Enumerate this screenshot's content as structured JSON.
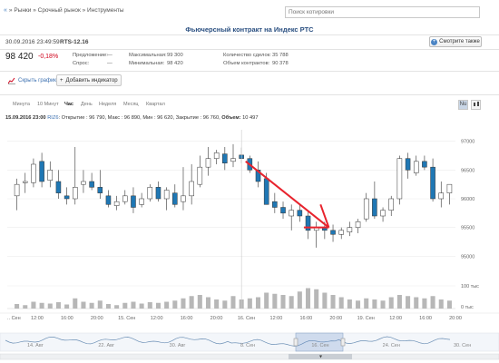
{
  "breadcrumb": {
    "home": "«",
    "path": "» Рынки » Срочный рынок » Инструменты"
  },
  "search": {
    "placeholder": "Поиск котировки"
  },
  "title": "Фьючерсный контракт на Индекс РТС",
  "header": {
    "datetime": "30.09.2016 23:49:59",
    "ticker": "RTS-12.16",
    "watch_label": "Смотрите также",
    "price": "98 420",
    "change": "-0,18%"
  },
  "stats": [
    {
      "label": "Предложение:",
      "value": "—"
    },
    {
      "label": "Спрос:",
      "value": "—"
    },
    {
      "label": "Максимальная:",
      "value": "99 300"
    },
    {
      "label": "Минимальная:",
      "value": "98 420"
    },
    {
      "label": "Количество сделок:",
      "value": "35 788"
    },
    {
      "label": "Объем контрактов:",
      "value": "90 378"
    }
  ],
  "toolbar": {
    "hide_chart": "Скрыть график",
    "add_indicator": "Добавить индикатор"
  },
  "periods": [
    "Минута",
    "10 Минут",
    "Час",
    "День",
    "Неделя",
    "Месяц",
    "Квартал"
  ],
  "active_period": "Час",
  "chart_controls": [
    "Nu"
  ],
  "ohlc": {
    "datetime": "15.09.2016 23:00",
    "ticker": "RIZ6",
    "text": ": Открытие : 96 790, Макс : 96 890, Мин : 96 620, Закрытие : 96 760,",
    "volume_label": "Объем:",
    "volume": "10 497"
  },
  "colors": {
    "up": "#ffffff",
    "down": "#1f77b4",
    "arrow": "#e8232d",
    "title": "#2a4f80"
  },
  "chart_data": {
    "type": "candlestick",
    "y_ticks": [
      "97000",
      "96500",
      "96000",
      "95500",
      "95000"
    ],
    "ylim": [
      94800,
      97200
    ],
    "volume_ticks": [
      "100 тыс",
      "0 тыс"
    ],
    "volume_max": 100,
    "x_labels": [
      ".. Сен",
      "12:00",
      "16:00",
      "20:00",
      "15. Сен",
      "12:00",
      "16:00",
      "20:00",
      "16. Сен",
      "12:00",
      "16:00",
      "20:00",
      "19. Сен",
      "12:00",
      "16:00",
      "20:00"
    ],
    "candles": [
      {
        "o": 96050,
        "h": 96350,
        "l": 95800,
        "c": 96250
      },
      {
        "o": 96280,
        "h": 96450,
        "l": 96100,
        "c": 96300
      },
      {
        "o": 96280,
        "h": 96700,
        "l": 96200,
        "c": 96600
      },
      {
        "o": 96650,
        "h": 96800,
        "l": 96200,
        "c": 96300
      },
      {
        "o": 96320,
        "h": 96650,
        "l": 96200,
        "c": 96500
      },
      {
        "o": 96300,
        "h": 96500,
        "l": 96000,
        "c": 96100
      },
      {
        "o": 96050,
        "h": 96200,
        "l": 95900,
        "c": 96000
      },
      {
        "o": 96000,
        "h": 96900,
        "l": 95900,
        "c": 96200
      },
      {
        "o": 96250,
        "h": 96500,
        "l": 96100,
        "c": 96300
      },
      {
        "o": 96300,
        "h": 96450,
        "l": 96150,
        "c": 96200
      },
      {
        "o": 96200,
        "h": 96500,
        "l": 96000,
        "c": 96100
      },
      {
        "o": 96050,
        "h": 96150,
        "l": 95850,
        "c": 95900
      },
      {
        "o": 95880,
        "h": 96050,
        "l": 95800,
        "c": 95950
      },
      {
        "o": 95950,
        "h": 96150,
        "l": 95900,
        "c": 96050
      },
      {
        "o": 96050,
        "h": 96200,
        "l": 95750,
        "c": 95850
      },
      {
        "o": 95900,
        "h": 96100,
        "l": 95850,
        "c": 96000
      },
      {
        "o": 96000,
        "h": 96250,
        "l": 95950,
        "c": 96200
      },
      {
        "o": 96200,
        "h": 96300,
        "l": 95950,
        "c": 96000
      },
      {
        "o": 96000,
        "h": 96200,
        "l": 95800,
        "c": 96150
      },
      {
        "o": 96100,
        "h": 96250,
        "l": 95850,
        "c": 95900
      },
      {
        "o": 95950,
        "h": 96550,
        "l": 95800,
        "c": 96050
      },
      {
        "o": 96050,
        "h": 96600,
        "l": 95900,
        "c": 96300
      },
      {
        "o": 96250,
        "h": 96750,
        "l": 96200,
        "c": 96550
      },
      {
        "o": 96550,
        "h": 96900,
        "l": 96400,
        "c": 96700
      },
      {
        "o": 96700,
        "h": 96850,
        "l": 96600,
        "c": 96800
      },
      {
        "o": 96780,
        "h": 96900,
        "l": 96500,
        "c": 96620
      },
      {
        "o": 96650,
        "h": 96950,
        "l": 96550,
        "c": 96700
      },
      {
        "o": 96760,
        "h": 96890,
        "l": 96620,
        "c": 96700
      },
      {
        "o": 96700,
        "h": 96750,
        "l": 96450,
        "c": 96500
      },
      {
        "o": 96500,
        "h": 96650,
        "l": 96200,
        "c": 96300
      },
      {
        "o": 96350,
        "h": 96450,
        "l": 95900,
        "c": 95900
      },
      {
        "o": 95950,
        "h": 96100,
        "l": 95750,
        "c": 95850
      },
      {
        "o": 95850,
        "h": 95950,
        "l": 95650,
        "c": 95750
      },
      {
        "o": 95700,
        "h": 95900,
        "l": 95450,
        "c": 95800
      },
      {
        "o": 95800,
        "h": 95900,
        "l": 95600,
        "c": 95700
      },
      {
        "o": 95700,
        "h": 95800,
        "l": 95300,
        "c": 95450
      },
      {
        "o": 95450,
        "h": 95600,
        "l": 95150,
        "c": 95500
      },
      {
        "o": 95500,
        "h": 95600,
        "l": 95300,
        "c": 95450
      },
      {
        "o": 95450,
        "h": 95550,
        "l": 95250,
        "c": 95380
      },
      {
        "o": 95380,
        "h": 95500,
        "l": 95300,
        "c": 95450
      },
      {
        "o": 95420,
        "h": 95600,
        "l": 95350,
        "c": 95500
      },
      {
        "o": 95500,
        "h": 95650,
        "l": 95400,
        "c": 95600
      },
      {
        "o": 95650,
        "h": 96100,
        "l": 95600,
        "c": 96000
      },
      {
        "o": 96000,
        "h": 96300,
        "l": 95650,
        "c": 95700
      },
      {
        "o": 95700,
        "h": 95850,
        "l": 95600,
        "c": 95800
      },
      {
        "o": 95800,
        "h": 96050,
        "l": 95700,
        "c": 96000
      },
      {
        "o": 96000,
        "h": 96750,
        "l": 95900,
        "c": 96700
      },
      {
        "o": 96700,
        "h": 96800,
        "l": 96350,
        "c": 96500
      },
      {
        "o": 96450,
        "h": 96750,
        "l": 96400,
        "c": 96650
      },
      {
        "o": 96650,
        "h": 96750,
        "l": 96500,
        "c": 96550
      },
      {
        "o": 96550,
        "h": 96700,
        "l": 95950,
        "c": 96000
      },
      {
        "o": 96000,
        "h": 96300,
        "l": 95850,
        "c": 96100
      },
      {
        "o": 96100,
        "h": 96250,
        "l": 95900,
        "c": 96250
      }
    ],
    "volumes": [
      20,
      15,
      30,
      25,
      22,
      28,
      18,
      45,
      30,
      25,
      35,
      20,
      15,
      25,
      30,
      22,
      28,
      25,
      30,
      35,
      45,
      55,
      60,
      50,
      40,
      35,
      55,
      40,
      45,
      50,
      70,
      65,
      60,
      55,
      75,
      90,
      85,
      70,
      60,
      50,
      40,
      35,
      45,
      40,
      35,
      50,
      60,
      55,
      50,
      45,
      55,
      40,
      35
    ],
    "navigator": {
      "labels": [
        "14. Авг",
        "22. Авг",
        "30. Авг",
        "8. Сен",
        "16. Сен",
        "24. Сен",
        "30. Сен"
      ]
    }
  }
}
